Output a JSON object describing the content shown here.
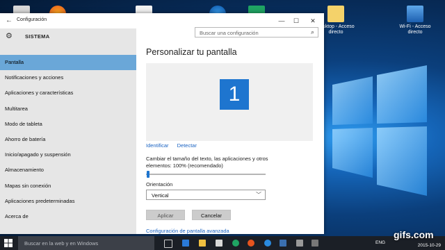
{
  "window": {
    "title": "Configuración",
    "back_icon": "back-arrow-icon",
    "minimize": "—",
    "maximize": "☐",
    "close": "✕"
  },
  "sidebar": {
    "header": "SISTEMA",
    "header_icon": "gear-icon",
    "search_placeholder": "Buscar una configuración",
    "items": [
      {
        "label": "Pantalla",
        "active": true
      },
      {
        "label": "Notificaciones y acciones"
      },
      {
        "label": "Aplicaciones y características"
      },
      {
        "label": "Multitarea"
      },
      {
        "label": "Modo de tableta"
      },
      {
        "label": "Ahorro de batería"
      },
      {
        "label": "Inicio/apagado y suspensión"
      },
      {
        "label": "Almacenamiento"
      },
      {
        "label": "Mapas sin conexión"
      },
      {
        "label": "Aplicaciones predeterminadas"
      },
      {
        "label": "Acerca de"
      }
    ]
  },
  "main": {
    "title": "Personalizar tu pantalla",
    "monitor_number": "1",
    "identify": "Identificar",
    "detect": "Detectar",
    "scale_label": "Cambiar el tamaño del texto, las aplicaciones y otros elementos: 100% (recomendado)",
    "scale_value_percent": 100,
    "orientation_label": "Orientación",
    "orientation_value": "Vertical",
    "apply": "Aplicar",
    "cancel": "Cancelar",
    "advanced_link": "Configuración de pantalla avanzada"
  },
  "desktop": {
    "icons": [
      {
        "label": "desktop - Acceso directo"
      },
      {
        "label": "Wi-Fi - Acceso directo"
      }
    ]
  },
  "taskbar": {
    "search_placeholder": "Buscar en la web y en Windows",
    "language": "ENG",
    "date": "2015-10-29"
  },
  "watermark": "gifs.com",
  "colors": {
    "accent": "#1e75cf",
    "nav_active": "#6aa7d8",
    "link": "#1a63c2"
  }
}
